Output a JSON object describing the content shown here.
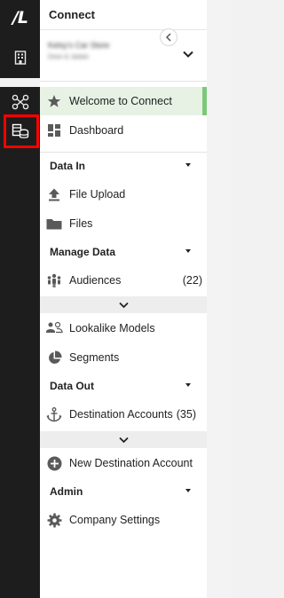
{
  "rail": {
    "logo_text": "/L",
    "icons": [
      "building-icon",
      "connections-icon",
      "connect-database-icon"
    ]
  },
  "panel": {
    "title": "Connect",
    "account": {
      "name": "Kelsy's Car Store",
      "subtitle": "Dean & Jadalo"
    }
  },
  "nav": {
    "welcome": "Welcome to Connect",
    "dashboard": "Dashboard",
    "data_in": "Data In",
    "file_upload": "File Upload",
    "files": "Files",
    "manage_data": "Manage Data",
    "audiences": "Audiences",
    "audiences_count": "(22)",
    "lookalike_models": "Lookalike Models",
    "segments": "Segments",
    "data_out": "Data Out",
    "destination_accounts": "Destination Accounts",
    "destination_accounts_count": "(35)",
    "new_destination_account": "New Destination Account",
    "admin": "Admin",
    "company_settings": "Company Settings"
  },
  "colors": {
    "rail": "#1d1d1d",
    "active_bg": "#e7f2e4",
    "active_border": "#7cc97a",
    "highlight": "#ff0000",
    "icon": "#5a5a5a"
  }
}
